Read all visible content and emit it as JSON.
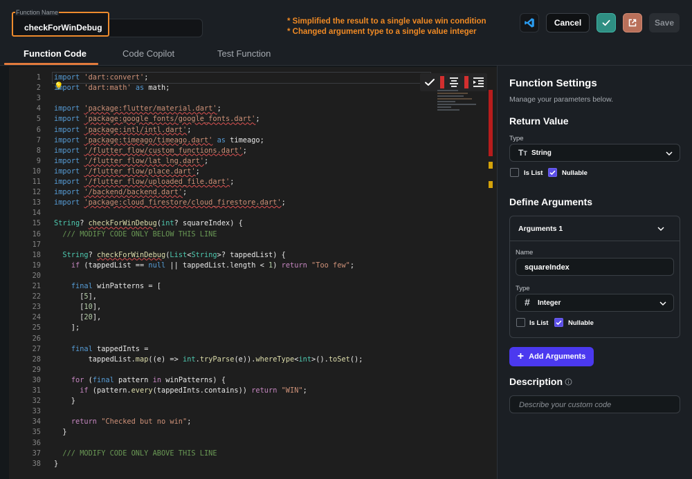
{
  "header": {
    "function_name_label": "Function Name",
    "function_name_value": "checkForWinDebug",
    "notes": [
      "* Simplified the result to a single value win condition",
      "* Changed argument type to a single value integer"
    ],
    "cancel_label": "Cancel",
    "save_label": "Save"
  },
  "tabs": [
    {
      "label": "Function Code",
      "active": true
    },
    {
      "label": "Code Copilot",
      "active": false
    },
    {
      "label": "Test Function",
      "active": false
    }
  ],
  "editor": {
    "line_numbers": [
      "1",
      "2",
      "3",
      "4",
      "5",
      "6",
      "7",
      "8",
      "9",
      "10",
      "11",
      "12",
      "13",
      "14",
      "15",
      "16",
      "17",
      "18",
      "19",
      "20",
      "21",
      "22",
      "23",
      "24",
      "25",
      "26",
      "27",
      "28",
      "29",
      "30",
      "31",
      "32",
      "33",
      "34",
      "35",
      "36",
      "37",
      "38"
    ],
    "code_lines": [
      "import 'dart:convert';",
      "import 'dart:math' as math;",
      "",
      "import 'package:flutter/material.dart';",
      "import 'package:google_fonts/google_fonts.dart';",
      "import 'package:intl/intl.dart';",
      "import 'package:timeago/timeago.dart' as timeago;",
      "import '/flutter_flow/custom_functions.dart';",
      "import '/flutter_flow/lat_lng.dart';",
      "import '/flutter_flow/place.dart';",
      "import '/flutter_flow/uploaded_file.dart';",
      "import '/backend/backend.dart';",
      "import 'package:cloud_firestore/cloud_firestore.dart';",
      "",
      "String? checkForWinDebug(int? squareIndex) {",
      "  /// MODIFY CODE ONLY BELOW THIS LINE",
      "",
      "  String? checkForWinDebug(List<String>? tappedList) {",
      "    if (tappedList == null || tappedList.length < 1) return \"Too few\";",
      "",
      "    final winPatterns = [",
      "      [5],",
      "      [10],",
      "      [20],",
      "    ];",
      "",
      "    final tappedInts =",
      "        tappedList.map((e) => int.tryParse(e)).whereType<int>().toSet();",
      "",
      "    for (final pattern in winPatterns) {",
      "      if (pattern.every(tappedInts.contains)) return \"WIN\";",
      "    }",
      "",
      "    return \"Checked but no win\";",
      "  }",
      "",
      "  /// MODIFY CODE ONLY ABOVE THIS LINE",
      "}"
    ]
  },
  "panel": {
    "title": "Function Settings",
    "subtitle": "Manage your parameters below.",
    "return_value": {
      "heading": "Return Value",
      "type_label": "Type",
      "type_value": "String",
      "type_icon": "text-type-icon",
      "is_list_label": "Is List",
      "is_list": false,
      "nullable_label": "Nullable",
      "nullable": true
    },
    "arguments": {
      "heading": "Define Arguments",
      "card_title": "Arguments 1",
      "name_label": "Name",
      "name_value": "squareIndex",
      "type_label": "Type",
      "type_value": "Integer",
      "type_icon": "hash-icon",
      "is_list_label": "Is List",
      "is_list": false,
      "nullable_label": "Nullable",
      "nullable": true
    },
    "add_button_label": "Add Arguments",
    "description": {
      "heading": "Description",
      "placeholder": "Describe your custom code"
    }
  },
  "colors": {
    "accent": "#4b39ef",
    "highlight_border": "#ee8b2d",
    "notes_text": "#f08a24",
    "tab_underline": "#e37b3c"
  }
}
